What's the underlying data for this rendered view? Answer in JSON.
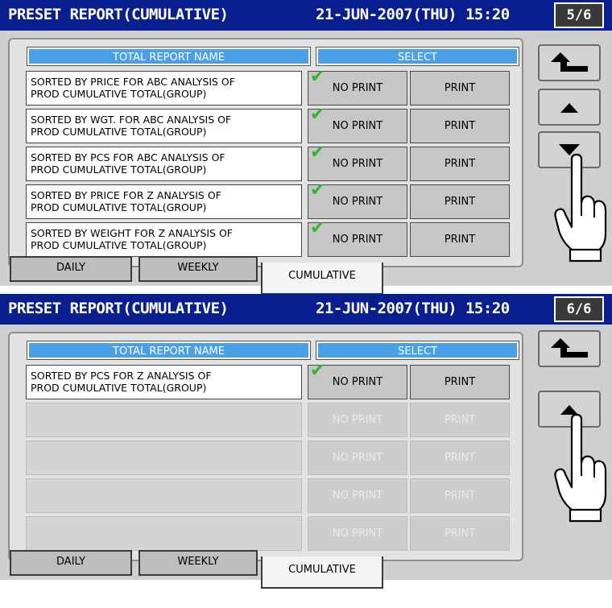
{
  "screens": [
    {
      "title": "PRESET REPORT(CUMULATIVE)",
      "datetime": "21-JUN-2007(THU) 15:20",
      "page": "5/6",
      "header_name": "TOTAL REPORT NAME",
      "header_select": "SELECT",
      "rows": [
        {
          "name": "SORTED BY PRICE FOR ABC ANALYSIS OF\nPROD CUMULATIVE TOTAL(GROUP)",
          "no_print": "NO PRINT",
          "print": "PRINT"
        },
        {
          "name": "SORTED BY WGT. FOR ABC ANALYSIS OF\nPROD CUMULATIVE TOTAL(GROUP)",
          "no_print": "NO PRINT",
          "print": "PRINT"
        },
        {
          "name": "SORTED BY PCS FOR ABC ANALYSIS OF\nPROD CUMULATIVE TOTAL(GROUP)",
          "no_print": "NO PRINT",
          "print": "PRINT"
        },
        {
          "name": "SORTED BY PRICE FOR Z ANALYSIS OF\nPROD CUMULATIVE TOTAL(GROUP)",
          "no_print": "NO PRINT",
          "print": "PRINT"
        },
        {
          "name": "SORTED BY WEIGHT FOR Z ANALYSIS OF\nPROD CUMULATIVE TOTAL(GROUP)",
          "no_print": "NO PRINT",
          "print": "PRINT"
        }
      ],
      "tabs": [
        "DAILY",
        "WEEKLY",
        "CUMULATIVE"
      ]
    },
    {
      "title": "PRESET REPORT(CUMULATIVE)",
      "datetime": "21-JUN-2007(THU) 15:20",
      "page": "6/6",
      "header_name": "TOTAL REPORT NAME",
      "header_select": "SELECT",
      "rows": [
        {
          "name": "SORTED BY PCS FOR Z ANALYSIS OF\nPROD CUMULATIVE TOTAL(GROUP)",
          "no_print": "NO PRINT",
          "print": "PRINT"
        },
        {
          "name": "",
          "no_print": "NO PRINT",
          "print": "PRINT"
        },
        {
          "name": "",
          "no_print": "NO PRINT",
          "print": "PRINT"
        },
        {
          "name": "",
          "no_print": "NO PRINT",
          "print": "PRINT"
        },
        {
          "name": "",
          "no_print": "NO PRINT",
          "print": "PRINT"
        }
      ],
      "tabs": [
        "DAILY",
        "WEEKLY",
        "CUMULATIVE"
      ]
    }
  ],
  "icons": {
    "check": "check-icon",
    "back": "back-arrow-icon",
    "up": "up-arrow-icon",
    "down": "down-arrow-icon",
    "hand": "pointing-hand-icon"
  }
}
